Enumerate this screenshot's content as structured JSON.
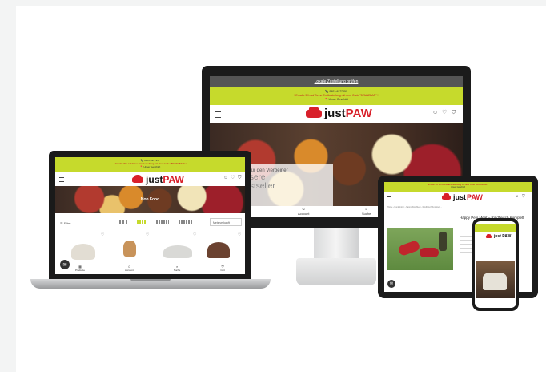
{
  "brand": {
    "logo_text_1": "just",
    "logo_text_2": "PAW"
  },
  "monitor": {
    "top_link": "Lokale Zustellung prüfen",
    "phone": "📞 0421-6977957",
    "promo": "! Erhalte 5% auf Deine Erstbestellung mit dem Code \"5PAW2BAR\" !",
    "shop": "📍 Unser Geschäft",
    "hero_line1": "für den Vierbeiner",
    "hero_line2": "sere",
    "hero_line3": "stseller",
    "nav_account": "Account",
    "nav_search": "Suche"
  },
  "laptop": {
    "phone": "📞 0421-6977957",
    "promo": "! Erhalte 5% auf Deine Erstbestellung mit dem Code \"5PAW2BAR\" !",
    "shop": "📍 Unser Geschäft",
    "category": "Non Food",
    "filter": "Filter",
    "sort": "Meistverkauft",
    "nav": [
      "Produkte",
      "Account",
      "Suche",
      "Cart"
    ]
  },
  "tablet": {
    "promo": "Erhalte 5% auf Deine Erstbestellung mit dem Code \"5PAW2BAR\"",
    "shop": "Unser Geschäft",
    "breadcrumb": "Home › Hundefutter › Happy Pets Meat - Rindfleisch Komplett ...",
    "product_title": "Happy Pets Meat – Rindfleisch Komplett"
  },
  "phone": {
    "label": "just PAW"
  }
}
